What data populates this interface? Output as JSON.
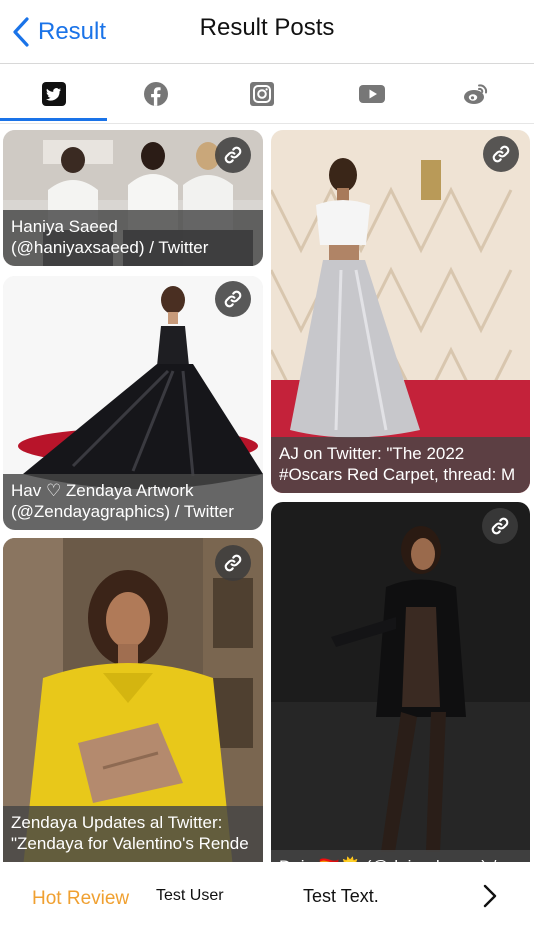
{
  "header": {
    "back_label": "Result",
    "title": "Result Posts"
  },
  "tabs": [
    {
      "name": "twitter",
      "icon": "twitter-icon",
      "selected": true
    },
    {
      "name": "facebook",
      "icon": "facebook-icon",
      "selected": false
    },
    {
      "name": "instagram",
      "icon": "instagram-icon",
      "selected": false
    },
    {
      "name": "youtube",
      "icon": "youtube-icon",
      "selected": false
    },
    {
      "name": "weibo",
      "icon": "weibo-icon",
      "selected": false
    }
  ],
  "posts": [
    {
      "line1": "Haniya Saeed",
      "line2": "(@haniyaxsaeed) / Twitter"
    },
    {
      "line1": "AJ on Twitter: \"The 2022",
      "line2": "#Oscars Red Carpet, thread: M"
    },
    {
      "line1": "Hav ♡ Zendaya Artwork",
      "line2": "(@Zendayagraphics) / Twitter"
    },
    {
      "line1": "Zendaya Updates al Twitter:",
      "line2": "\"Zendaya for Valentino's Rende"
    },
    {
      "line1": "Deja 🏳️‍🌈🌞 (@deja_demos) /",
      "line2": ""
    }
  ],
  "bottom": {
    "hot_review": "Hot Review",
    "user": "Test User",
    "text": "Test Text."
  },
  "colors": {
    "accent": "#1a73e8",
    "hot_review": "#f0a030"
  }
}
